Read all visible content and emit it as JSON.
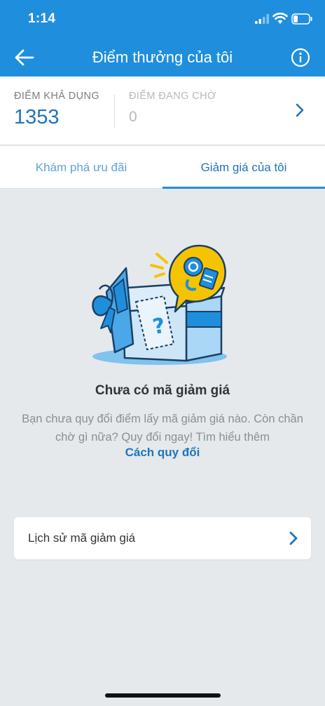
{
  "status_bar": {
    "time": "1:14"
  },
  "header": {
    "title": "Điểm thưởng của tôi"
  },
  "points": {
    "available_label": "ĐIỂM KHẢ DỤNG",
    "available_value": "1353",
    "pending_label": "ĐIỂM ĐANG CHỜ",
    "pending_value": "0"
  },
  "tabs": [
    {
      "label": "Khám phá ưu đãi",
      "active": false
    },
    {
      "label": "Giảm giá của tôi",
      "active": true
    }
  ],
  "empty_state": {
    "title": "Chưa có mã giảm giá",
    "description": "Bạn chưa quy đổi điểm lấy mã giảm giá nào. Còn chần chờ gì nữa? Quy đổi ngay! Tìm hiểu thêm",
    "link": "Cách quy đổi"
  },
  "history": {
    "label": "Lịch sử mã giảm giá"
  },
  "colors": {
    "header_blue": "#1f8fdd",
    "accent_blue": "#1f74bd",
    "background": "#e5e9ec",
    "bubble_yellow": "#f5c400"
  },
  "icons": {
    "back": "arrow-left-icon",
    "info": "info-circle-icon",
    "chevron": "chevron-right-icon",
    "illustration": "open-gift-box-coupon-illustration"
  }
}
